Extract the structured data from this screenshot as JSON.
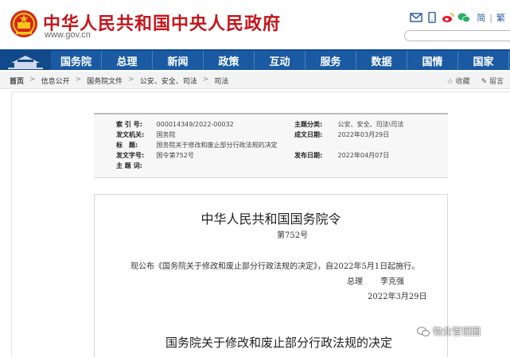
{
  "header": {
    "site_title": "中华人民共和国中央人民政府",
    "site_url": "www.gov.cn",
    "lang_simplified": "简",
    "lang_separator": "|",
    "lang_traditional": "繁",
    "top_icons": [
      "mail-icon",
      "mobile-icon",
      "weibo-icon",
      "wechat-icon"
    ]
  },
  "nav": {
    "items": [
      "国务院",
      "总理",
      "新闻",
      "政策",
      "互动",
      "服务",
      "数据",
      "国情",
      "国家"
    ]
  },
  "breadcrumb": {
    "items": [
      "首页",
      "信息公开",
      "国务院文件",
      "公安、安全、司法",
      "司法"
    ],
    "separator": ">",
    "actions": [
      "☆ 收藏",
      "✎ 留言"
    ]
  },
  "meta": {
    "index_key": "索 引 号:",
    "index_val": "000014349/2022-00032",
    "category_key": "主题分类:",
    "category_val": "公安、安全、司法\\司法",
    "issuer_key": "发文机关:",
    "issuer_val": "国务院",
    "created_key": "成文日期:",
    "created_val": "2022年03月29日",
    "title_key": "标　题:",
    "title_val": "国务院关于修改和废止部分行政法规的决定",
    "docno_key": "发文字号:",
    "docno_val": "国令第752号",
    "published_key": "发布日期:",
    "published_val": "2022年04月07日",
    "keywords_key": "主 题 词:"
  },
  "article": {
    "title": "中华人民共和国国务院令",
    "number": "第752号",
    "body": "现公布《国务院关于修改和废止部分行政法规的决定》，自2022年5月1日起施行。",
    "sign_role": "总理",
    "sign_name": "李克强",
    "date": "2022年3月29日",
    "heading": "国务院关于修改和废止部分行政法规的决定"
  },
  "watermark": {
    "text": "物业管理圈"
  },
  "colors": {
    "brand_red": "#c4161c",
    "nav_blue": "#1a5aa3"
  }
}
